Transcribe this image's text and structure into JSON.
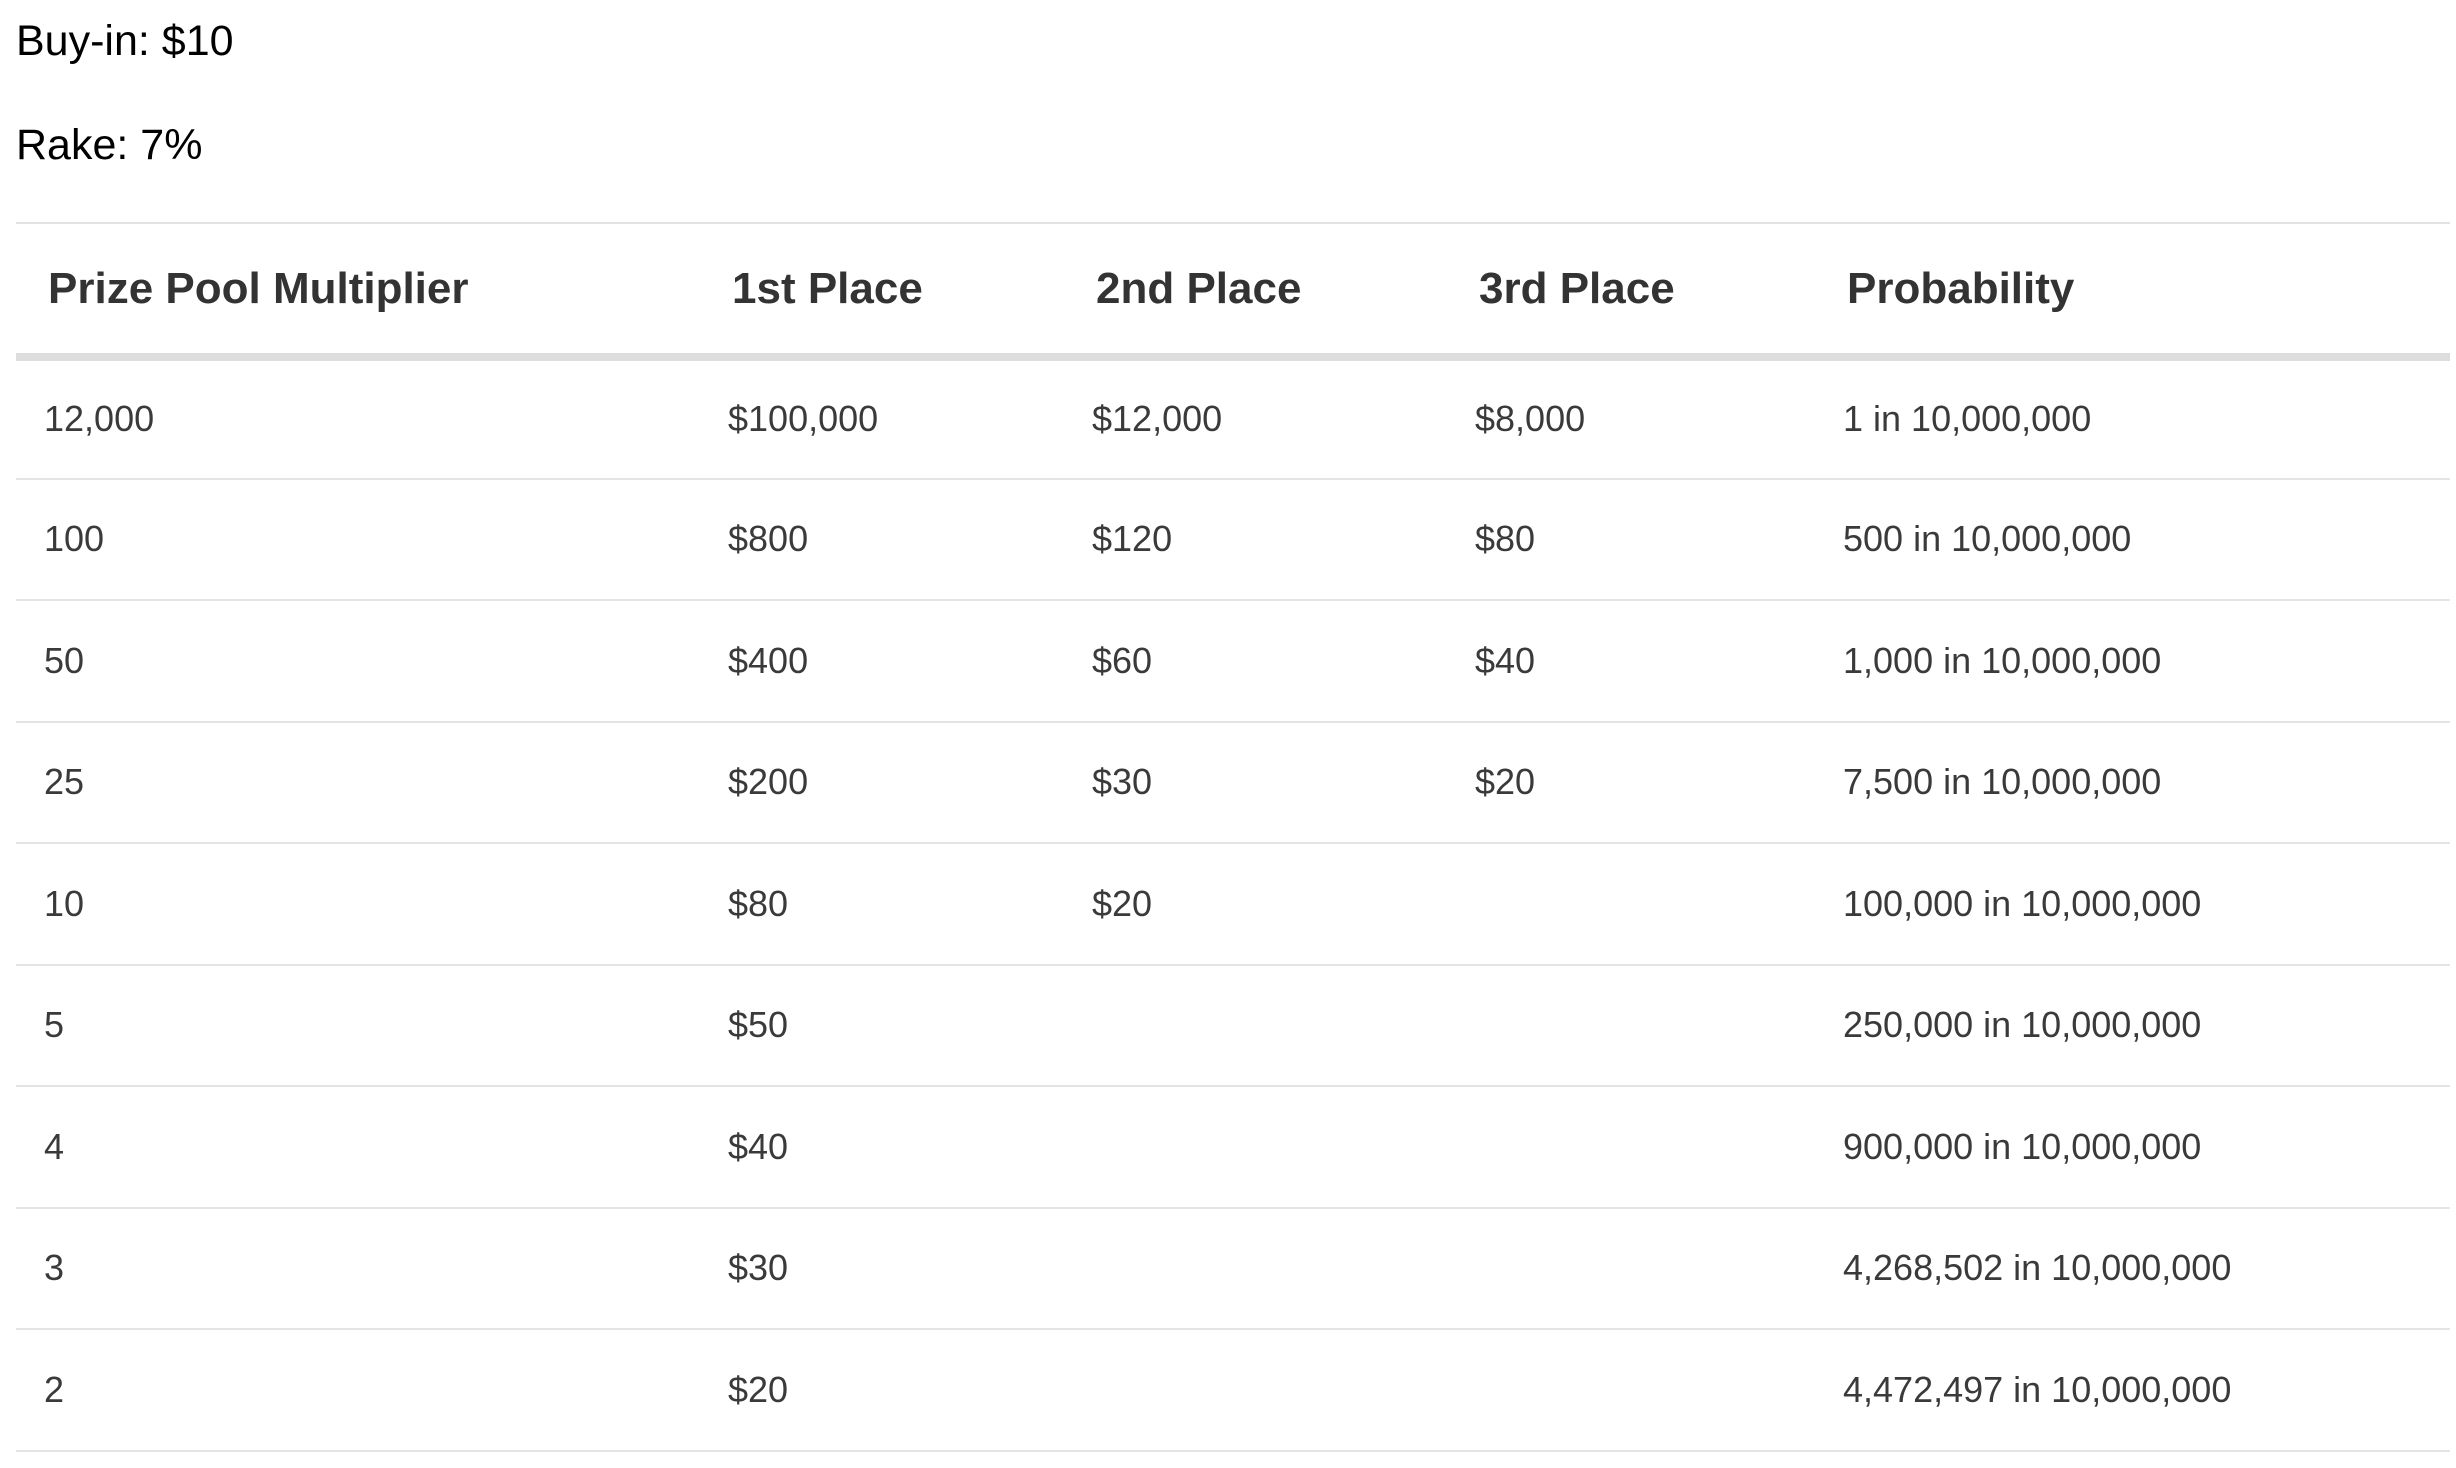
{
  "info": {
    "buyin": "Buy-in: $10",
    "rake": "Rake: 7%"
  },
  "table": {
    "headers": [
      "Prize Pool Multiplier",
      "1st Place",
      "2nd Place",
      "3rd Place",
      "Probability"
    ],
    "rows": [
      [
        "12,000",
        "$100,000",
        "$12,000",
        "$8,000",
        "1 in 10,000,000"
      ],
      [
        "100",
        "$800",
        "$120",
        "$80",
        "500 in 10,000,000"
      ],
      [
        "50",
        "$400",
        "$60",
        "$40",
        "1,000 in 10,000,000"
      ],
      [
        "25",
        "$200",
        "$30",
        "$20",
        "7,500 in 10,000,000"
      ],
      [
        "10",
        "$80",
        "$20",
        "",
        "100,000 in 10,000,000"
      ],
      [
        "5",
        "$50",
        "",
        "",
        "250,000 in 10,000,000"
      ],
      [
        "4",
        "$40",
        "",
        "",
        "900,000 in 10,000,000"
      ],
      [
        "3",
        "$30",
        "",
        "",
        "4,268,502 in 10,000,000"
      ],
      [
        "2",
        "$20",
        "",
        "",
        "4,472,497 in 10,000,000"
      ]
    ]
  }
}
